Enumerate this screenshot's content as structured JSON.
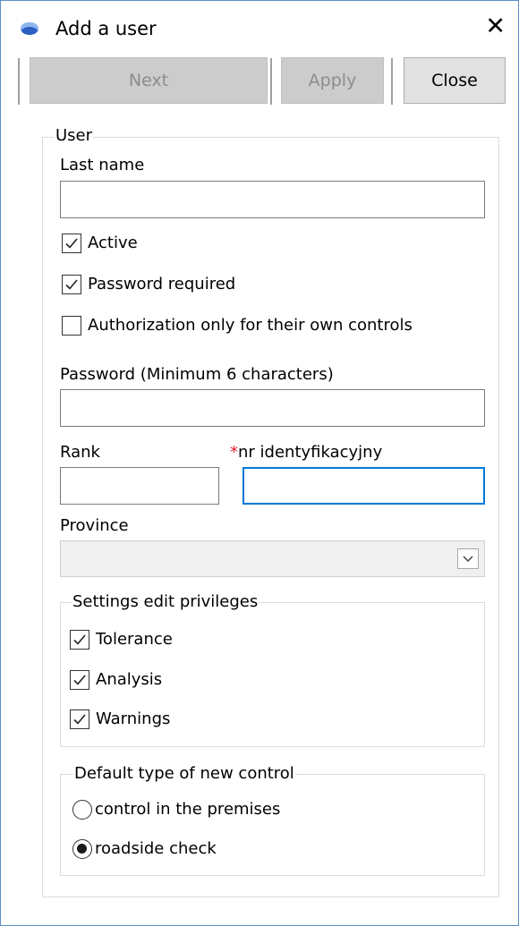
{
  "window": {
    "title": "Add a user",
    "close_glyph": "✕"
  },
  "toolbar": {
    "next_label": "Next",
    "apply_label": "Apply",
    "close_label": "Close"
  },
  "user_group": {
    "legend": "User",
    "last_name_label": "Last name",
    "last_name_value": "",
    "active_label": "Active",
    "active_checked": true,
    "password_required_label": "Password required",
    "password_required_checked": true,
    "auth_own_label": "Authorization only for their own controls",
    "auth_own_checked": false,
    "password_label": "Password (Minimum 6 characters)",
    "password_value": "",
    "rank_label": "Rank",
    "rank_value": "",
    "id_required_mark": "*",
    "id_label": "nr identyfikacyjny",
    "id_value": "",
    "province_label": "Province",
    "province_value": ""
  },
  "privileges_group": {
    "legend": "Settings edit privileges",
    "items": [
      {
        "label": "Tolerance",
        "checked": true
      },
      {
        "label": "Analysis",
        "checked": true
      },
      {
        "label": "Warnings",
        "checked": true
      }
    ]
  },
  "default_type_group": {
    "legend": "Default type of new control",
    "options": [
      {
        "label": "control in the premises",
        "selected": false
      },
      {
        "label": "roadside check",
        "selected": true
      }
    ]
  },
  "colors": {
    "focus_border": "#0078d7",
    "required_mark": "#e0202a",
    "window_border": "#5a8fc8"
  },
  "icons": {
    "app": "app-icon",
    "close": "close-icon",
    "check": "checkmark-icon",
    "dropdown": "chevron-down-icon"
  }
}
